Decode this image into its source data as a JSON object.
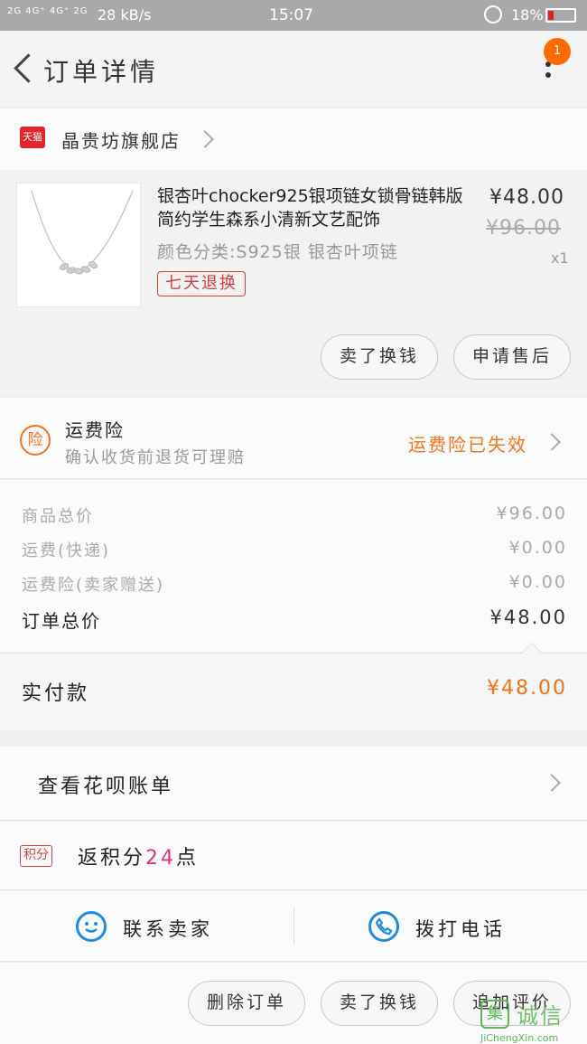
{
  "status_bar": {
    "signal": "2G 4G⁺ 4G⁺ 2G",
    "speed": "28 kB/s",
    "time": "15:07",
    "battery": "18%"
  },
  "header": {
    "title": "订单详情",
    "badge_count": "1"
  },
  "shop": {
    "badge": "天猫",
    "name": "晶贵坊旗舰店"
  },
  "item": {
    "title": "银杏叶chocker925银项链女锁骨链韩版简约学生森系小清新文艺配饰",
    "spec": "颜色分类:S925银 银杏叶项链",
    "return_tag": "七天退换",
    "price_now": "¥48.00",
    "price_old": "¥96.00",
    "quantity": "x1",
    "btn_sell": "卖了换钱",
    "btn_aftersale": "申请售后"
  },
  "insurance": {
    "icon_text": "险",
    "title": "运费险",
    "subtitle": "确认收货前退货可理赔",
    "status": "运费险已失效"
  },
  "summary": {
    "rows": [
      {
        "label": "商品总价",
        "value": "¥96.00"
      },
      {
        "label": "运费(快递)",
        "value": "¥0.00"
      },
      {
        "label": "运费险(卖家赠送)",
        "value": "¥0.00"
      },
      {
        "label": "订单总价",
        "value": "¥48.00"
      }
    ]
  },
  "payment": {
    "label": "实付款",
    "amount": "¥48.00"
  },
  "huabei": {
    "label": "查看花呗账单"
  },
  "points": {
    "tag": "积分",
    "prefix": "返积分",
    "value": "24",
    "suffix": "点"
  },
  "contact": {
    "seller": "联系卖家",
    "call": "拨打电话"
  },
  "actions": {
    "delete": "删除订单",
    "sell": "卖了换钱",
    "review": "追加评价"
  },
  "watermark": {
    "logo": "集",
    "name": "诚信",
    "url": "JiChengXin.com"
  },
  "colors": {
    "accent_orange": "#f2731c",
    "tmall_red": "#e1262b",
    "link_blue": "#1d8ce0",
    "points_pink": "#e0307a"
  }
}
